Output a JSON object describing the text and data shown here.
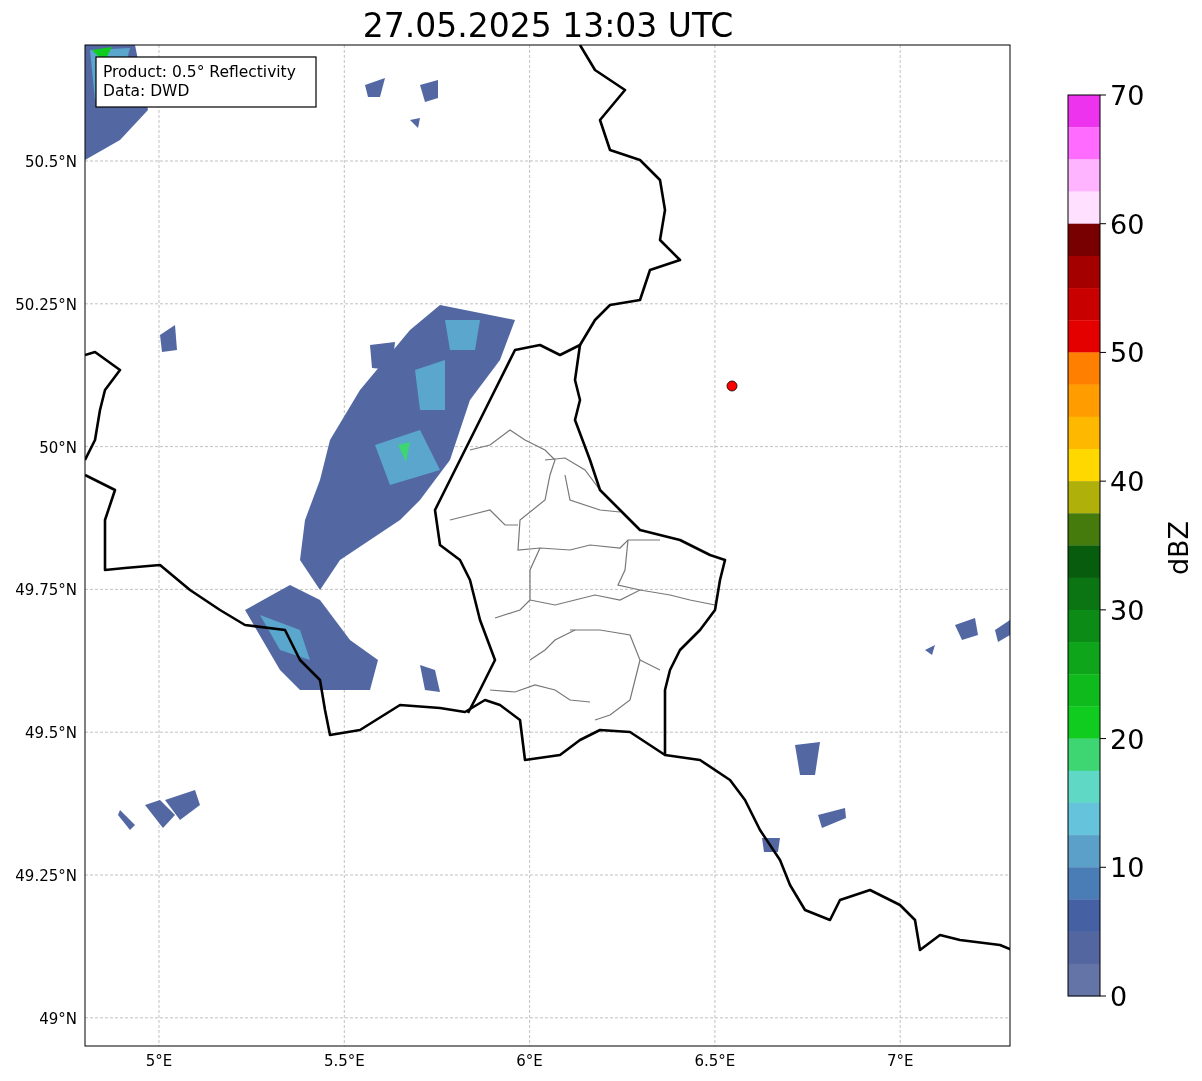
{
  "title": "27.05.2025 13:03 UTC",
  "info_box": {
    "lines": [
      "Product: 0.5° Reflectivity",
      "Data: DWD"
    ]
  },
  "map": {
    "kind": "map",
    "yticks": [
      "50.5°N",
      "50.25°N",
      "50°N",
      "49.75°N",
      "49.5°N",
      "49.25°N",
      "49°N"
    ],
    "xticks": [
      "5°E",
      "5.5°E",
      "6°E",
      "6.5°E",
      "7°E"
    ]
  },
  "colorbar": {
    "label": "dBZ",
    "ticks": [
      "70",
      "60",
      "50",
      "40",
      "30",
      "20",
      "10",
      "0"
    ],
    "bins": [
      {
        "color": "#ee33ee"
      },
      {
        "color": "#ff6aff"
      },
      {
        "color": "#ffb4ff"
      },
      {
        "color": "#ffe0ff"
      },
      {
        "color": "#780000"
      },
      {
        "color": "#a50000"
      },
      {
        "color": "#c80000"
      },
      {
        "color": "#e50000"
      },
      {
        "color": "#ff7f00"
      },
      {
        "color": "#ff9c00"
      },
      {
        "color": "#ffb800"
      },
      {
        "color": "#ffd800"
      },
      {
        "color": "#b0b00a"
      },
      {
        "color": "#457a0c"
      },
      {
        "color": "#085c0e"
      },
      {
        "color": "#0a7512"
      },
      {
        "color": "#0c8c16"
      },
      {
        "color": "#0ea51a"
      },
      {
        "color": "#0fba1d"
      },
      {
        "color": "#10cc1f"
      },
      {
        "color": "#3dd672"
      },
      {
        "color": "#5fd8c6"
      },
      {
        "color": "#66c3dc"
      },
      {
        "color": "#5aa0c8"
      },
      {
        "color": "#4a7db5"
      },
      {
        "color": "#4560a3"
      },
      {
        "color": "#5466a0"
      },
      {
        "color": "#6574a7"
      }
    ]
  }
}
